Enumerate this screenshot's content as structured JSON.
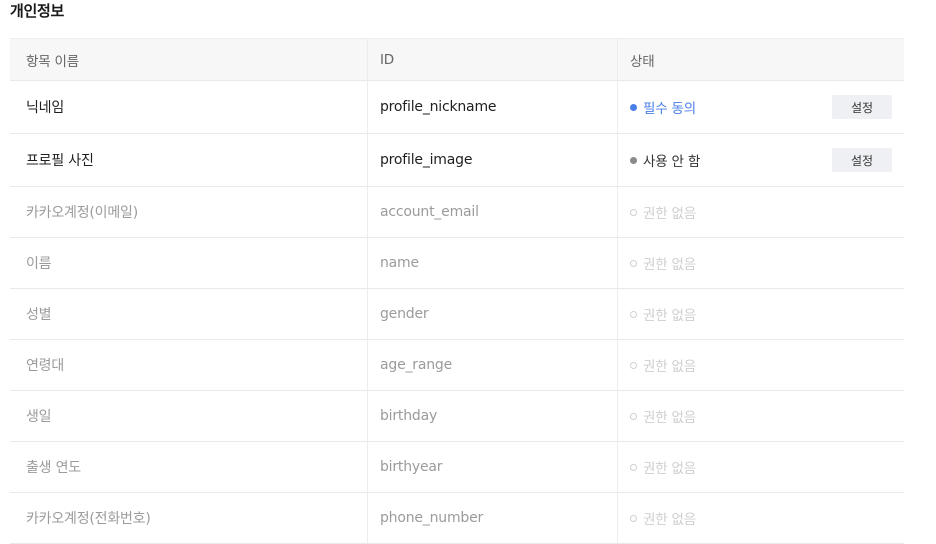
{
  "section_title": "개인정보",
  "table": {
    "headers": {
      "name": "항목 이름",
      "id": "ID",
      "status": "상태"
    },
    "rows": [
      {
        "name": "닉네임",
        "id": "profile_nickname",
        "status": "필수 동의",
        "status_type": "required",
        "button": "설정"
      },
      {
        "name": "프로필 사진",
        "id": "profile_image",
        "status": "사용 안 함",
        "status_type": "off",
        "button": "설정"
      },
      {
        "name": "카카오계정(이메일)",
        "id": "account_email",
        "status": "권한 없음",
        "status_type": "none"
      },
      {
        "name": "이름",
        "id": "name",
        "status": "권한 없음",
        "status_type": "none"
      },
      {
        "name": "성별",
        "id": "gender",
        "status": "권한 없음",
        "status_type": "none"
      },
      {
        "name": "연령대",
        "id": "age_range",
        "status": "권한 없음",
        "status_type": "none"
      },
      {
        "name": "생일",
        "id": "birthday",
        "status": "권한 없음",
        "status_type": "none"
      },
      {
        "name": "출생 연도",
        "id": "birthyear",
        "status": "권한 없음",
        "status_type": "none"
      },
      {
        "name": "카카오계정(전화번호)",
        "id": "phone_number",
        "status": "권한 없음",
        "status_type": "none"
      }
    ]
  },
  "colors": {
    "required": "#4a7ee8",
    "off": "#8a8a8a",
    "none": "#cfcfcf",
    "header_bg": "#f7f7f8",
    "button_bg": "#eef0f3"
  }
}
